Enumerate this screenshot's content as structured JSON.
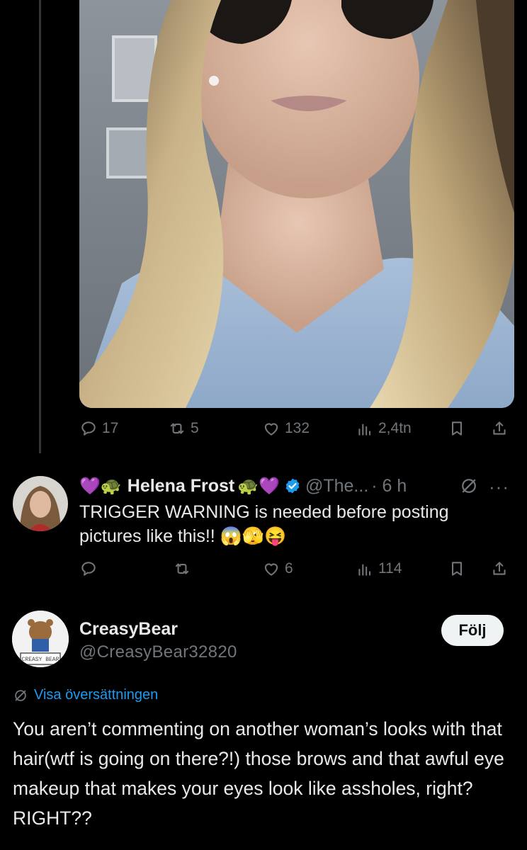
{
  "original_post": {
    "actions": {
      "replies": "17",
      "reposts": "5",
      "likes": "132",
      "views": "2,4tn"
    }
  },
  "reply": {
    "emoji_left": "💜🐢",
    "name": "Helena Frost",
    "emoji_right": "🐢💜",
    "handle": "@The...",
    "time": "· 6 h",
    "text": "TRIGGER WARNING is needed before posting pictures like this!! 😱🫣😝",
    "actions": {
      "replies": "",
      "reposts": "",
      "likes": "6",
      "views": "114"
    },
    "more_label": "···"
  },
  "post": {
    "name": "CreasyBear",
    "handle": "@CreasyBear32820",
    "follow_label": "Följ",
    "avatar_text": "CREASY BEAR",
    "translate_label": "Visa översättningen",
    "text": "You aren’t commenting on another woman’s looks with that hair(wtf is going on there?!) those brows and that awful eye makeup that makes your eyes look like assholes, right? RIGHT??"
  },
  "colors": {
    "background": "#000000",
    "text": "#e7e9ea",
    "muted": "#71767b",
    "link": "#1d9bf0",
    "verified": "#1d9bf0"
  },
  "icons": {
    "reply": "speech-bubble-icon",
    "repost": "repost-arrows-icon",
    "like": "heart-icon",
    "views": "bar-chart-icon",
    "bookmark": "bookmark-icon",
    "share": "share-upload-icon",
    "no_translate": "no-translate-icon",
    "verified": "verified-badge-icon"
  }
}
